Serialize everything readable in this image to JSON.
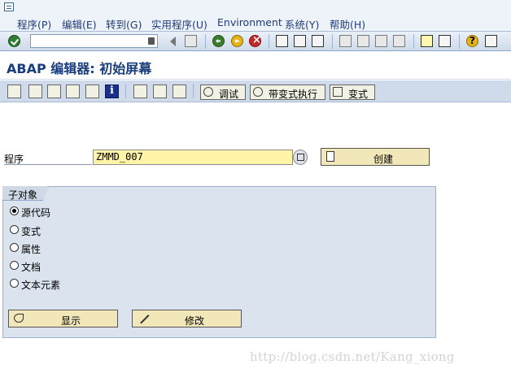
{
  "menubar": {
    "items": [
      "程序(P)",
      "编辑(E)",
      "转到(G)",
      "实用程序(U)",
      "Environment",
      "系统(Y)",
      "帮助(H)"
    ]
  },
  "toolbar": {
    "command_value": ""
  },
  "title": "ABAP 编辑器: 初始屏幕",
  "app_toolbar": {
    "debug_label": "调试",
    "run_variant_label": "带变式执行",
    "variant_label": "变式"
  },
  "form": {
    "program_label": "程序",
    "program_value": "ZMMD_007",
    "create_label": "创建"
  },
  "subobjects": {
    "title": "子对象",
    "options": [
      {
        "label": "源代码",
        "selected": true
      },
      {
        "label": "变式",
        "selected": false
      },
      {
        "label": "属性",
        "selected": false
      },
      {
        "label": "文档",
        "selected": false
      },
      {
        "label": "文本元素",
        "selected": false
      }
    ],
    "display_label": "显示",
    "change_label": "修改"
  },
  "watermark": "http://blog.csdn.net/Kang_xiong"
}
